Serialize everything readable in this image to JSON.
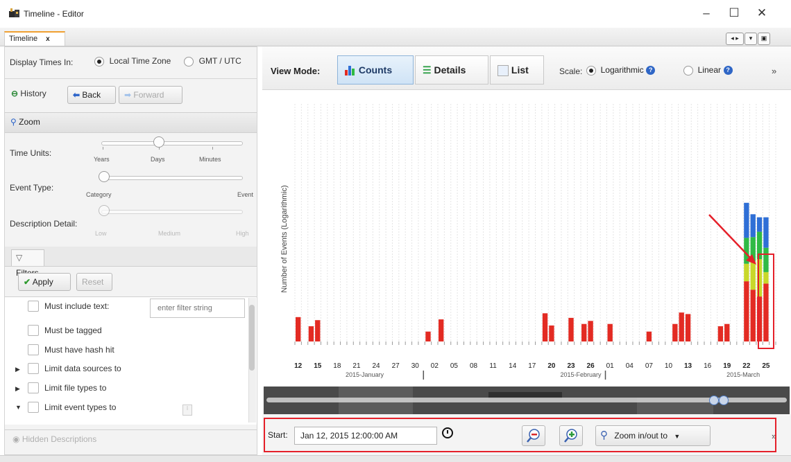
{
  "window": {
    "title": "Timeline - Editor",
    "controls": {
      "minimize": "–",
      "maximize": "☐",
      "close": "✕"
    }
  },
  "tabs": [
    {
      "label": "Timeline",
      "close": "x"
    }
  ],
  "left_panel": {
    "display_times_label": "Display Times In:",
    "timezone_options": [
      {
        "label": "Local Time Zone",
        "selected": true
      },
      {
        "label": "GMT / UTC",
        "selected": false
      }
    ],
    "history": {
      "label": "History",
      "back": "Back",
      "forward": "Forward"
    },
    "zoom": {
      "header": "Zoom",
      "time_units": {
        "label": "Time Units:",
        "ticks": [
          "Years",
          "Days",
          "Minutes"
        ],
        "value": "Days"
      },
      "event_type": {
        "label": "Event Type:",
        "ticks": [
          "Category",
          "Event"
        ],
        "value": "Category"
      },
      "description_detail": {
        "label": "Description Detail:",
        "ticks": [
          "Low",
          "Medium",
          "High"
        ],
        "value": "Low"
      }
    },
    "filters": {
      "tab_label": "Filters",
      "apply": "Apply",
      "reset": "Reset",
      "items": [
        {
          "label": "Must include text:",
          "expander": "",
          "placeholder": "enter filter string"
        },
        {
          "label": "Must be tagged",
          "expander": ""
        },
        {
          "label": "Must have hash hit",
          "expander": ""
        },
        {
          "label": "Limit data sources to",
          "expander": "▶"
        },
        {
          "label": "Limit file types to",
          "expander": "▶"
        },
        {
          "label": "Limit event types to",
          "expander": "▼"
        }
      ]
    },
    "hidden_descriptions": "Hidden Descriptions"
  },
  "toolbar": {
    "view_mode_label": "View Mode:",
    "view_modes": [
      {
        "label": "Counts",
        "active": true
      },
      {
        "label": "Details",
        "active": false
      },
      {
        "label": "List",
        "active": false
      }
    ],
    "scale_label": "Scale:",
    "scale_options": [
      {
        "label": "Logarithmic",
        "selected": true
      },
      {
        "label": "Linear",
        "selected": false
      }
    ],
    "overflow": "»"
  },
  "chart_data": {
    "type": "bar",
    "stacked": true,
    "scale": "logarithmic",
    "ylabel": "Number of Events (Logarithmic)",
    "xlabel": "",
    "tick_labels": [
      "12",
      "15",
      "18",
      "21",
      "24",
      "27",
      "30",
      "02",
      "05",
      "08",
      "11",
      "14",
      "17",
      "20",
      "23",
      "26",
      "01",
      "04",
      "07",
      "10",
      "13",
      "16",
      "19",
      "22",
      "25"
    ],
    "bold_ticks": [
      "12",
      "15",
      "20",
      "23",
      "26",
      "13",
      "19",
      "22",
      "25"
    ],
    "month_labels": [
      "2015-January",
      "2015-February",
      "2015-March"
    ],
    "series_colors": {
      "red": "#e32b23",
      "yellow": "#c8d82a",
      "green": "#2fba44",
      "blue": "#2f6fd6"
    },
    "bars": [
      {
        "day": "Jan 12",
        "red": 3.2
      },
      {
        "day": "Jan 14",
        "red": 2.0
      },
      {
        "day": "Jan 15",
        "red": 2.8
      },
      {
        "day": "Feb 01",
        "red": 1.3
      },
      {
        "day": "Feb 03",
        "red": 2.9
      },
      {
        "day": "Feb 19",
        "red": 3.7
      },
      {
        "day": "Feb 20",
        "red": 2.1
      },
      {
        "day": "Feb 23",
        "red": 3.1
      },
      {
        "day": "Feb 25",
        "red": 2.3
      },
      {
        "day": "Feb 26",
        "red": 2.7
      },
      {
        "day": "Mar 01",
        "red": 2.3
      },
      {
        "day": "Mar 07",
        "red": 1.3
      },
      {
        "day": "Mar 11",
        "red": 2.3
      },
      {
        "day": "Mar 12",
        "red": 3.8
      },
      {
        "day": "Mar 13",
        "red": 3.6
      },
      {
        "day": "Mar 18",
        "red": 2.0
      },
      {
        "day": "Mar 19",
        "red": 2.3
      },
      {
        "day": "Mar 22",
        "red": 7.9,
        "yellow": 2.3,
        "green": 3.4,
        "blue": 4.6
      },
      {
        "day": "Mar 23",
        "red": 6.8,
        "yellow": 3.7,
        "green": 3.2,
        "blue": 3.0
      },
      {
        "day": "Mar 24",
        "red": 5.9,
        "yellow": 4.9,
        "green": 3.6,
        "blue": 1.9
      },
      {
        "day": "Mar 25",
        "red": 7.6,
        "yellow": 1.5,
        "green": 3.2,
        "blue": 4.0
      }
    ]
  },
  "navigator": {
    "from": "2015-01-12",
    "to": "2015-03-25"
  },
  "bottom_bar": {
    "start_label": "Start:",
    "start_value": "Jan 12, 2015 12:00:00 AM",
    "zoom_out_to": "Zoom in/out to",
    "overflow": "»"
  },
  "highlight_color": "#e5202a"
}
